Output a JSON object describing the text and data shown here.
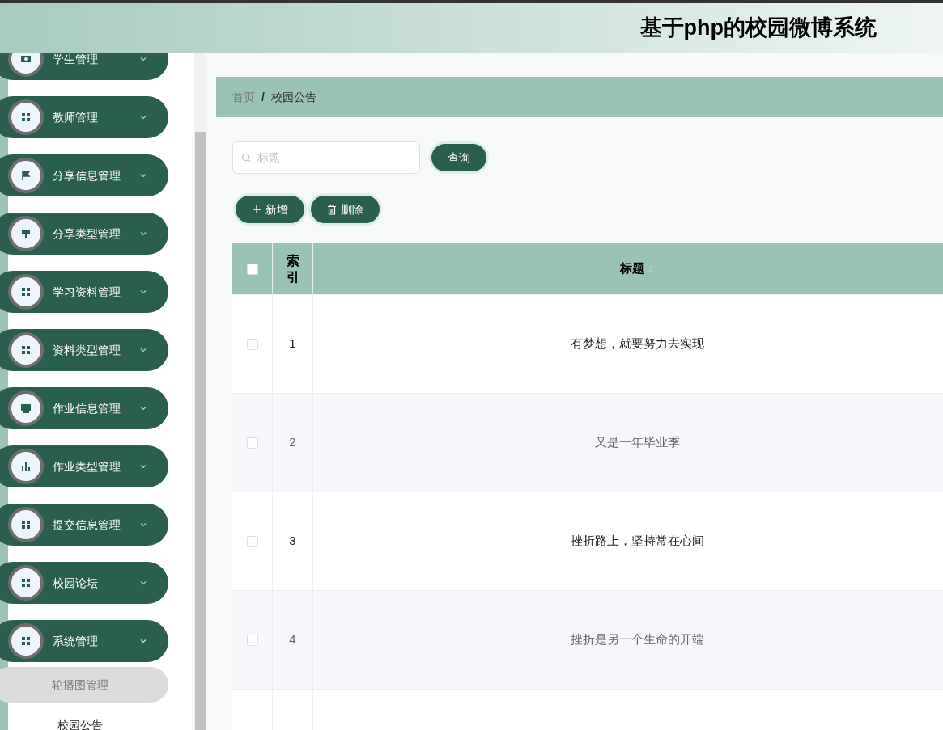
{
  "header": {
    "title": "基于php的校园微博系统"
  },
  "sidebar": {
    "items": [
      {
        "label": "学生管理",
        "expanded": false
      },
      {
        "label": "教师管理",
        "expanded": false
      },
      {
        "label": "分享信息管理",
        "expanded": false
      },
      {
        "label": "分享类型管理",
        "expanded": false
      },
      {
        "label": "学习资料管理",
        "expanded": false
      },
      {
        "label": "资料类型管理",
        "expanded": false
      },
      {
        "label": "作业信息管理",
        "expanded": false
      },
      {
        "label": "作业类型管理",
        "expanded": false
      },
      {
        "label": "提交信息管理",
        "expanded": false
      },
      {
        "label": "校园论坛",
        "expanded": false
      },
      {
        "label": "系统管理",
        "expanded": true,
        "children": [
          {
            "label": "轮播图管理",
            "selected": true
          },
          {
            "label": "校园公告",
            "selected": false
          }
        ]
      }
    ]
  },
  "breadcrumb": {
    "items": [
      "首页",
      "校园公告"
    ],
    "separator": "/"
  },
  "search": {
    "placeholder": "标题",
    "button": "查询"
  },
  "actions": [
    {
      "kind": "add",
      "label": "新增"
    },
    {
      "kind": "delete",
      "label": "删除"
    }
  ],
  "table": {
    "columns": [
      "索引",
      "标题"
    ],
    "all_checked": false,
    "rows": [
      {
        "index": "1",
        "title": "有梦想，就要努力去实现",
        "checked": false
      },
      {
        "index": "2",
        "title": "又是一年毕业季",
        "checked": false
      },
      {
        "index": "3",
        "title": "挫折路上，坚持常在心间",
        "checked": false
      },
      {
        "index": "4",
        "title": "挫折是另一个生命的开端",
        "checked": false
      }
    ]
  }
}
